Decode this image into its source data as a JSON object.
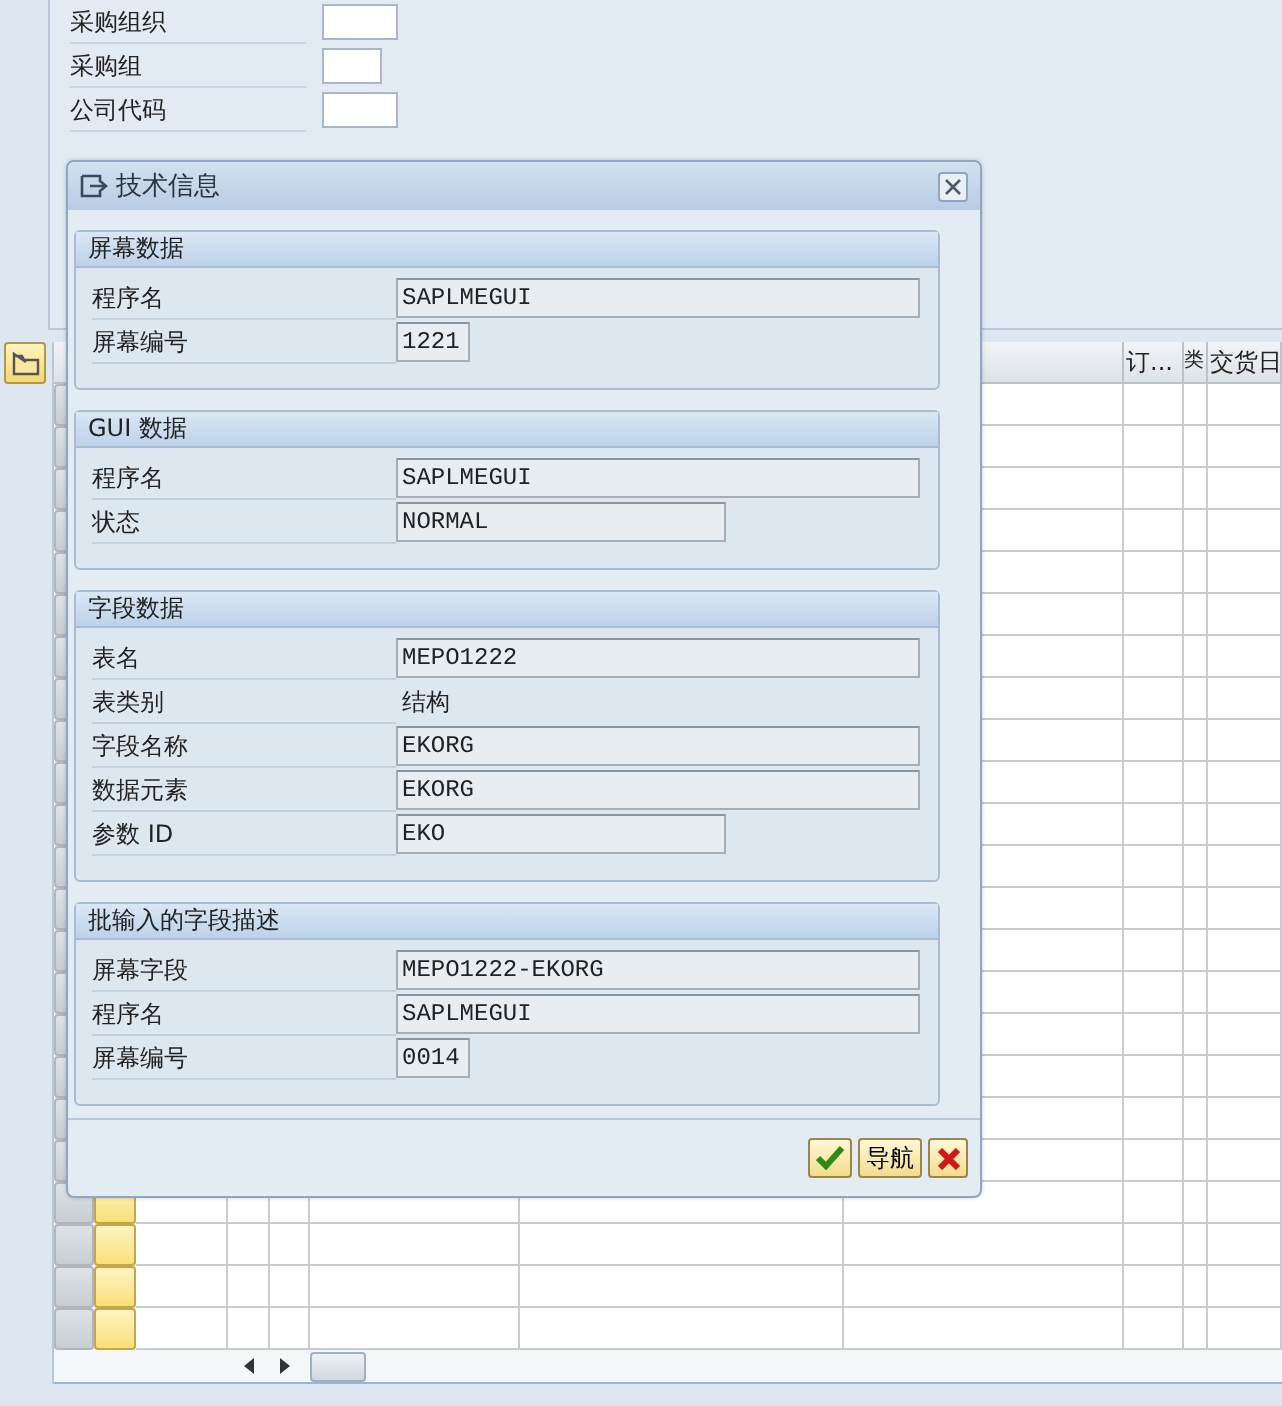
{
  "selection_form": {
    "fields": [
      {
        "label": "采购组织"
      },
      {
        "label": "采购组"
      },
      {
        "label": "公司代码"
      }
    ]
  },
  "table": {
    "headers": [
      {
        "label": "订..."
      },
      {
        "label": "类"
      },
      {
        "label": "交货日"
      }
    ]
  },
  "dialog": {
    "title": "技术信息",
    "groups": [
      {
        "title": "屏幕数据",
        "rows": [
          {
            "label": "程序名",
            "kind": "long",
            "value": "SAPLMEGUI"
          },
          {
            "label": "屏幕编号",
            "kind": "short",
            "value": "1221"
          }
        ]
      },
      {
        "title": "GUI 数据",
        "rows": [
          {
            "label": "程序名",
            "kind": "long",
            "value": "SAPLMEGUI"
          },
          {
            "label": "状态",
            "kind": "medium",
            "value": "NORMAL"
          }
        ]
      },
      {
        "title": "字段数据",
        "rows": [
          {
            "label": "表名",
            "kind": "long",
            "value": "MEPO1222"
          },
          {
            "label": "表类别",
            "kind": "text",
            "value": "结构"
          },
          {
            "label": "字段名称",
            "kind": "long",
            "value": "EKORG"
          },
          {
            "label": "数据元素",
            "kind": "long",
            "value": "EKORG"
          },
          {
            "label": "参数 ID",
            "kind": "medium",
            "value": "EKO"
          }
        ]
      },
      {
        "title": "批输入的字段描述",
        "rows": [
          {
            "label": "屏幕字段",
            "kind": "long",
            "value": "MEPO1222-EKORG"
          },
          {
            "label": "程序名",
            "kind": "long",
            "value": "SAPLMEGUI"
          },
          {
            "label": "屏幕编号",
            "kind": "short",
            "value": "0014"
          }
        ]
      }
    ],
    "buttons": [
      {
        "kind": "confirm"
      },
      {
        "kind": "text",
        "label": "导航"
      },
      {
        "kind": "cancel"
      }
    ]
  }
}
